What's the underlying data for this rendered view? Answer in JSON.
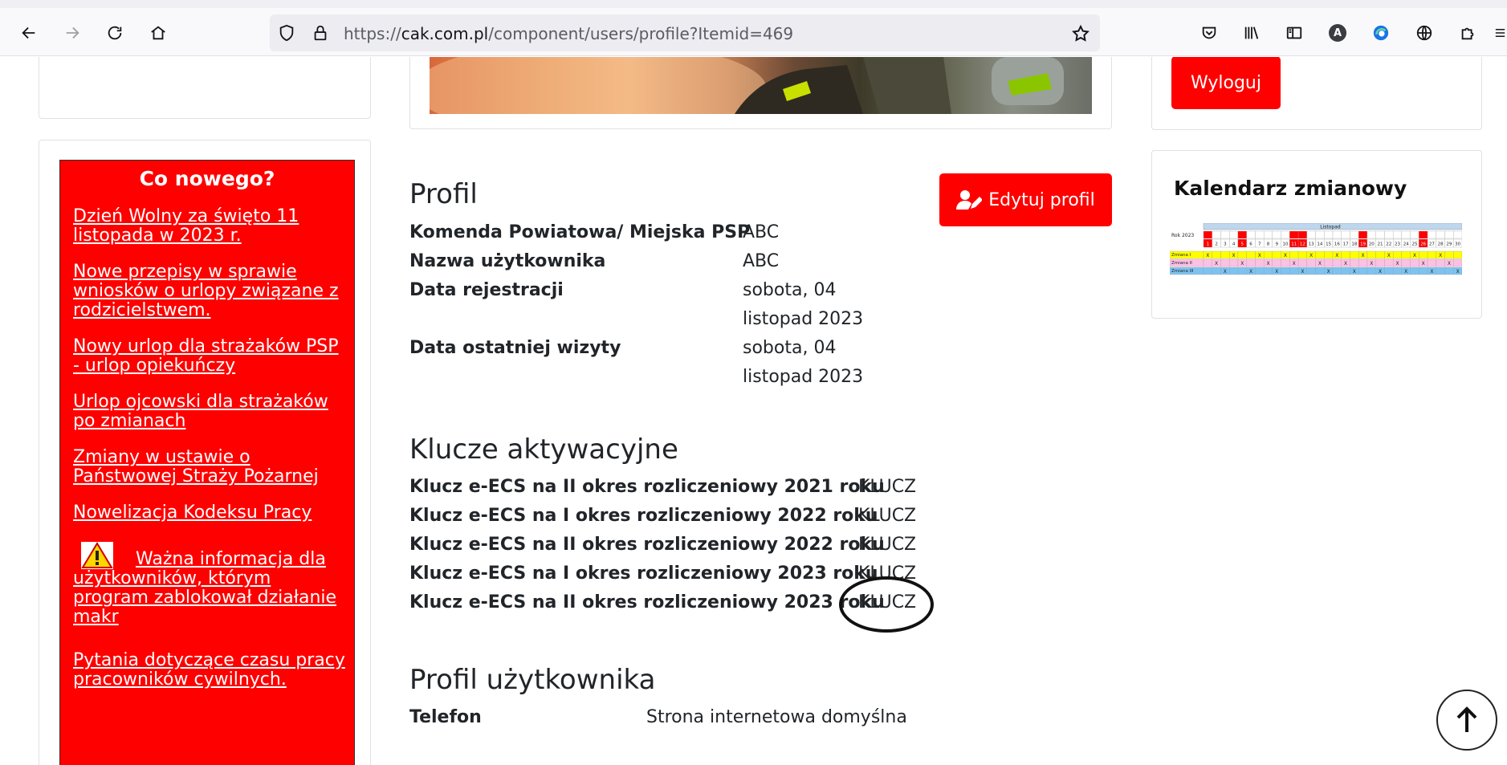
{
  "browser": {
    "url_prefix": "https://",
    "url_domain": "cak.com.pl",
    "url_path": "/component/users/profile?Itemid=469",
    "profile_initial": "A"
  },
  "sidebar": {
    "news_title": "Co nowego?",
    "news_items": [
      "Dzień Wolny za święto 11 listopada w 2023 r.",
      "Nowe przepisy w sprawie wniosków o urlopy związane z rodzicielstwem.",
      "Nowy urlop dla strażaków PSP - urlop opiekuńczy",
      "Urlop ojcowski dla strażaków po zmianach",
      "Zmiany w ustawie o Państwowej Straży Pożarnej",
      "Nowelizacja Kodeksu Pracy",
      "Ważna informacja dla użytkowników, którym program zablokował działanie makr",
      "Pytania dotyczące czasu pracy pracowników cywilnych."
    ]
  },
  "profile": {
    "heading": "Profil",
    "edit_button": "Edytuj profil",
    "rows": [
      {
        "label": "Komenda Powiatowa/ Miejska PSP",
        "value": "ABC"
      },
      {
        "label": "Nazwa użytkownika",
        "value": "ABC"
      },
      {
        "label": "Data rejestracji",
        "value_line1": "sobota, 04",
        "value_line2": "listopad 2023"
      },
      {
        "label": "Data ostatniej wizyty",
        "value_line1": "sobota, 04",
        "value_line2": "listopad 2023"
      }
    ]
  },
  "keys": {
    "heading": "Klucze aktywacyjne",
    "rows": [
      {
        "label": "Klucz e-ECS na II okres rozliczeniowy 2021 roku",
        "value": "KLUCZ"
      },
      {
        "label": "Klucz e-ECS na I okres rozliczeniowy 2022 roku",
        "value": "KLUCZ"
      },
      {
        "label": "Klucz e-ECS na II okres rozliczeniowy 2022 roku",
        "value": "KLUCZ"
      },
      {
        "label": "Klucz e-ECS na I okres rozliczeniowy 2023 roku",
        "value": "KLUCZ"
      },
      {
        "label": "Klucz e-ECS na II okres rozliczeniowy 2023 roku",
        "value": "KLUCZ"
      }
    ]
  },
  "user_profile": {
    "heading": "Profil użytkownika",
    "label": "Telefon",
    "value": "Strona internetowa domyślna"
  },
  "right": {
    "logout_button": "Wyloguj",
    "calendar_title": "Kalendarz zmianowy",
    "calendar": {
      "month": "Listopad",
      "year_label": "Rok 2023",
      "rows": [
        "Zmiana I",
        "Zmiana II",
        "Zmiana III"
      ],
      "days": 30,
      "highlighted_days": [
        1,
        5,
        11,
        12,
        19,
        26
      ],
      "colors": {
        "shift1": "#ffff00",
        "shift2": "#ffc0e6",
        "shift3": "#7ec3f0",
        "header": "#bdd7ee",
        "holiday": "#ff0000"
      }
    }
  },
  "colors": {
    "accent": "#ff0000",
    "text": "#212529"
  }
}
